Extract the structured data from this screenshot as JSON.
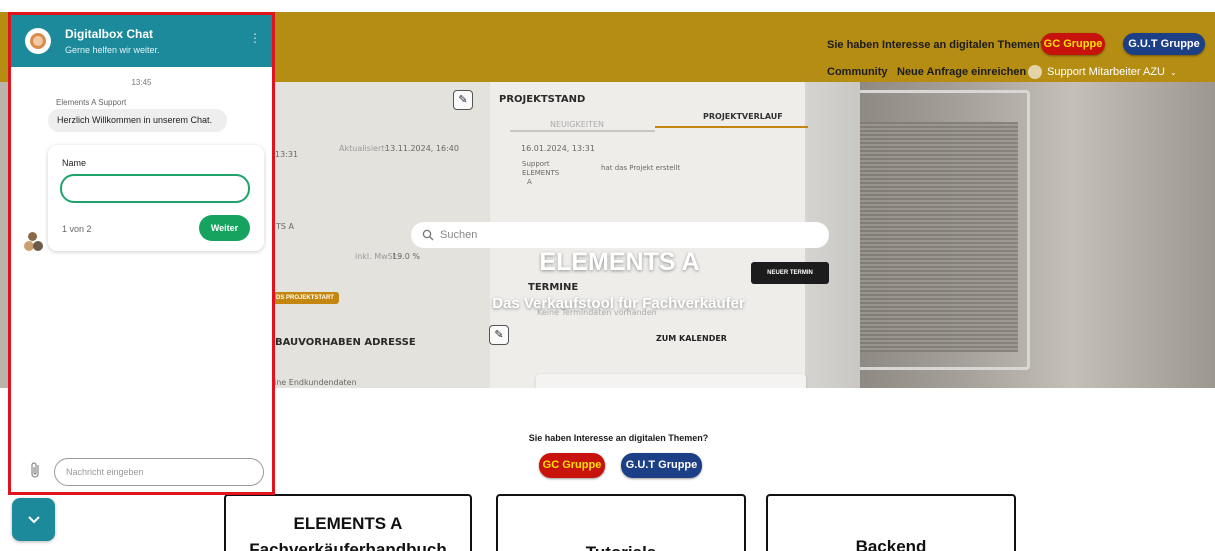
{
  "topbar": {
    "question": "Sie haben Interesse an digitalen Themen?",
    "gc_label": "GC Gruppe",
    "gut_label": "G.U.T Gruppe",
    "nav": {
      "community": "Community",
      "new_request": "Neue Anfrage einreichen",
      "user": "Support Mitarbeiter AZU"
    }
  },
  "hero": {
    "search_placeholder": "Suchen",
    "title": "ELEMENTS A",
    "subtitle": "Das Verkaufstool für Fachverkäufer",
    "mock": {
      "projektstand": "PROJEKTSTAND",
      "neuigkeiten": "NEUIGKEITEN",
      "projektverlauf": "PROJEKTVERLAUF",
      "date1": "16.01.2024, 13:31",
      "support": "Support",
      "elements": "ELEMENTS",
      "a": "A",
      "created": "hat das Projekt erstellt",
      "time_left": "13:31",
      "updated": "Aktualisiert:",
      "updated_date": "13.11.2024, 16:40",
      "ts_a": "TS A",
      "mwst": "inkl. MwSt.:",
      "mwst_val": "19.0 %",
      "projektstart": "DS PROJEKTSTART",
      "termine": "TERMINE",
      "no_dates": "Keine Termindaten vorhanden",
      "new_date": "NEUER TERMIN",
      "to_calendar": "ZUM KALENDER",
      "address": "BAUVORHABEN ADRESSE",
      "end_customer": "ine Endkundendaten"
    }
  },
  "middle": {
    "question": "Sie haben Interesse an digitalen Themen?",
    "gc_label": "GC Gruppe",
    "gut_label": "G.U.T Gruppe"
  },
  "tiles": [
    {
      "line1": "ELEMENTS A",
      "line2": "Fachverkäuferhandbuch"
    },
    {
      "line1": "Tutorials"
    },
    {
      "line1": "Backend"
    }
  ],
  "chat": {
    "title": "Digitalbox Chat",
    "subtitle": "Gerne helfen wir weiter.",
    "menu": "⋮",
    "time": "13:45",
    "sender": "Elements A Support",
    "welcome": "Herzlich Willkommen in unserem Chat.",
    "form": {
      "label": "Name",
      "value": "",
      "progress": "1 von 2",
      "next_label": "Weiter"
    },
    "input_placeholder": "Nachricht eingeben"
  },
  "colors": {
    "topbar": "#b58d12",
    "chat_teal": "#1c8a9a",
    "highlight_border": "#e0141e",
    "gc_red": "#c8120c",
    "gut_blue": "#1d3f86",
    "next_green": "#16a35f"
  },
  "icons": {
    "search": "search-icon",
    "attach": "paperclip-icon",
    "toggle": "chevron-down-icon",
    "menu": "kebab-menu-icon"
  }
}
